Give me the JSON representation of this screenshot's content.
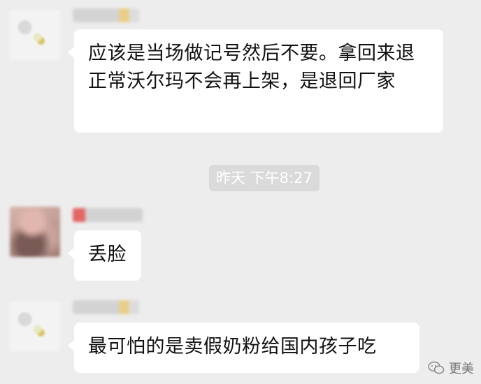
{
  "messages": [
    {
      "sender": "obscured-contact-1",
      "text": "应该是当场做记号然后不要。拿回来退正常沃尔玛不会再上架，是退回厂家"
    },
    {
      "sender": "obscured-contact-2",
      "text": "丢脸"
    },
    {
      "sender": "obscured-contact-1",
      "text": "最可怕的是卖假奶粉给国内孩子吃"
    }
  ],
  "timestamp": "昨天 下午8:27",
  "watermark": {
    "icon": "wechat-icon",
    "label": "更美"
  },
  "colors": {
    "background": "#ededed",
    "bubble": "#ffffff",
    "timestamp_pill": "#dadada",
    "text": "#111111"
  }
}
